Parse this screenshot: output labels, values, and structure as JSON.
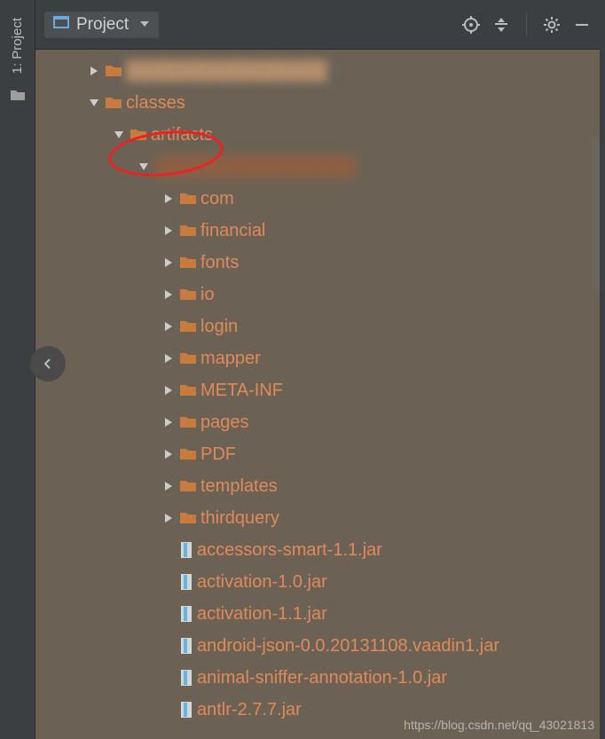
{
  "sidebar": {
    "tab_label": "1: Project"
  },
  "header": {
    "project_button": "Project"
  },
  "tree": {
    "root_blur": "████████████████",
    "classes": "classes",
    "artifacts": "artifacts",
    "artifact_blur": "██████████████",
    "folders": [
      "com",
      "financial",
      "fonts",
      "io",
      "login",
      "mapper",
      "META-INF",
      "pages",
      "PDF",
      "templates",
      "thirdquery"
    ],
    "jars": [
      "accessors-smart-1.1.jar",
      "activation-1.0.jar",
      "activation-1.1.jar",
      "android-json-0.0.20131108.vaadin1.jar",
      "animal-sniffer-annotation-1.0.jar",
      "antlr-2.7.7.jar"
    ]
  },
  "watermark": "https://blog.csdn.net/qq_43021813"
}
